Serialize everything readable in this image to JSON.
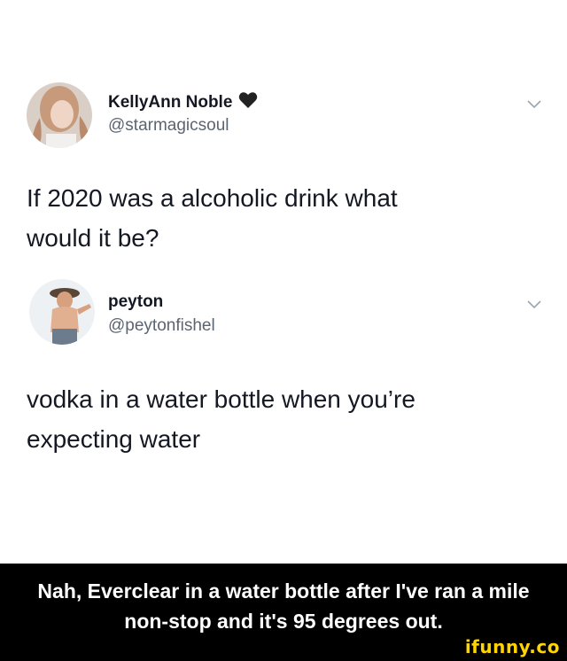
{
  "tweets": [
    {
      "name": "KellyAnn Noble",
      "badge_icon": "black-heart-icon",
      "handle": "@starmagicsoul",
      "text_lines": [
        "If 2020 was a alcoholic drink what",
        "would it be?"
      ]
    },
    {
      "name": "peyton",
      "handle": "@peytonfishel",
      "text_lines": [
        "vodka in a water bottle when you’re",
        "expecting water"
      ]
    }
  ],
  "caption": {
    "lines": [
      "Nah, Everclear in a water bottle after I've ran a mile",
      "non-stop and it's 95 degrees out."
    ]
  },
  "watermark": "ifunny.co",
  "colors": {
    "caption_background": "#000000",
    "caption_text": "#ffffff",
    "watermark": "#ffd400",
    "handle_text": "#5b6570"
  }
}
